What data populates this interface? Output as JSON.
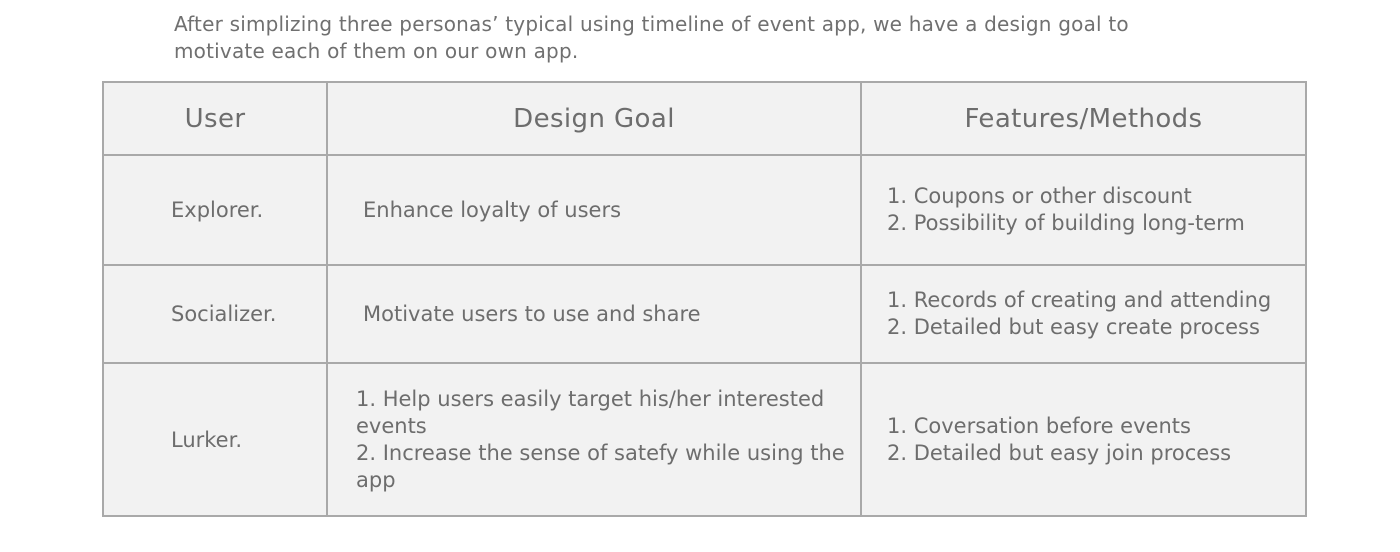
{
  "intro": {
    "line1": "After simplizing three personas’ typical using timeline of event app, we have a design goal to",
    "line2": "motivate each of them on our own app."
  },
  "table": {
    "headers": [
      "User",
      "Design Goal",
      "Features/Methods"
    ],
    "rows": [
      {
        "user": "Explorer.",
        "goal": [
          "Enhance loyalty of users"
        ],
        "features": [
          "1. Coupons or other discount",
          "2. Possibility of building long-term"
        ]
      },
      {
        "user": "Socializer.",
        "goal": [
          "Motivate users to use and share"
        ],
        "features": [
          "1. Records of creating and attending",
          "2. Detailed but easy create process"
        ]
      },
      {
        "user": "Lurker.",
        "goal": [
          "1. Help users easily target his/her interested events",
          "2. Increase the sense of satefy while using the app"
        ],
        "features": [
          "1. Coversation before events",
          "2. Detailed but easy join process"
        ]
      }
    ]
  },
  "colors": {
    "cell_background": "#f2f2f2",
    "border": "#a9a9a9",
    "text": "#6d6d6d"
  }
}
